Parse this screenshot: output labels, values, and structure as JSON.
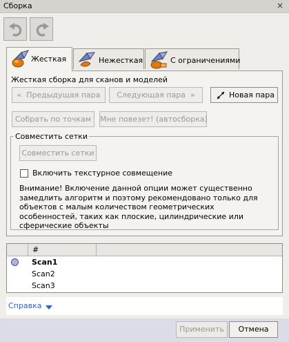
{
  "window": {
    "title": "Сборка",
    "close_glyph": "×"
  },
  "toolbar": {
    "undo_icon": "undo-arrow-icon",
    "redo_icon": "redo-arrow-icon"
  },
  "tabs": [
    {
      "label": "Жесткая",
      "active": true,
      "icon": "rigid-assembly-icon"
    },
    {
      "label": "Нежесткая",
      "active": false,
      "icon": "nonrigid-assembly-icon"
    },
    {
      "label": "С ограничениями",
      "active": false,
      "icon": "constrained-assembly-icon"
    }
  ],
  "rigid": {
    "title": "Жесткая сборка для сканов и моделей",
    "prev_pair": "Предыдущая пара",
    "next_pair": "Следующая пара",
    "new_pair": "Новая пара",
    "by_points": "Собрать по точкам",
    "auto": "Мне повезет! (автосборка)",
    "align_group": {
      "title": "Совместить сетки",
      "align_button": "Совместить сетки",
      "texture_checkbox": "Включить текстурное совмещение",
      "texture_checked": false,
      "warning": [
        "Внимание! Включение данной опции может существенно",
        "замедлить алгоритм и поэтому рекомендовано только для",
        "объектов с малым количеством геометрических",
        "особенностей, таких как плоские, цилиндрические или",
        "сферические объекты"
      ]
    }
  },
  "scan_list": {
    "header": "#",
    "rows": [
      {
        "name": "Scan1",
        "bold": true,
        "marker": true
      },
      {
        "name": "Scan2",
        "bold": false,
        "marker": false
      },
      {
        "name": "Scan3",
        "bold": false,
        "marker": false
      }
    ]
  },
  "help": {
    "label": "Справка"
  },
  "footer": {
    "apply": "Применить",
    "cancel": "Отмена"
  },
  "colors": {
    "accent_link": "#2c64c8",
    "footer_bg": "#dcdce8",
    "scan_marker": "#a9b4e8"
  }
}
